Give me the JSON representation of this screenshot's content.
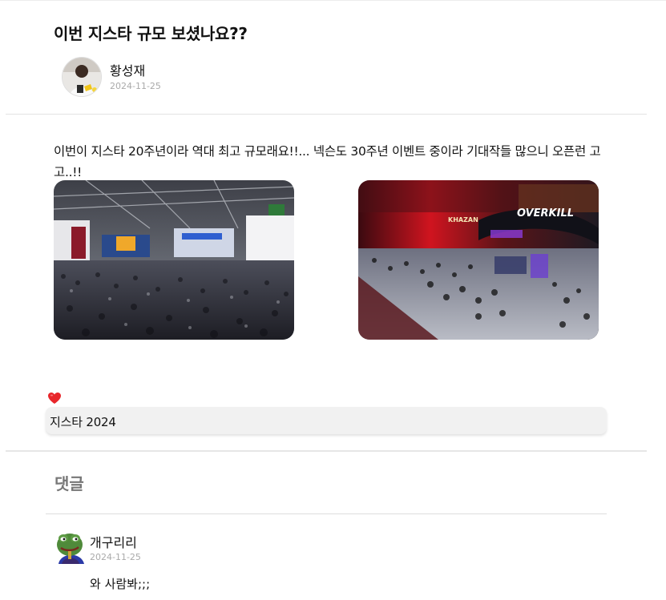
{
  "post": {
    "title": "이번 지스타 규모 보셨나요??",
    "author": {
      "name": "황성재",
      "date": "2024-11-25"
    },
    "body": "이번이 지스타 20주년이라 역대 최고 규모래요!!... 넥슨도 30주년 이벤트 중이라 기대작들 많으니 오픈런 고고..!!",
    "images": [
      {
        "name": "gstar-crowd-photo-1"
      },
      {
        "name": "gstar-crowd-photo-2",
        "signage": [
          "KHAZAN",
          "OVERKILL"
        ]
      }
    ],
    "liked": true,
    "tag": "지스타 2024"
  },
  "comments": {
    "heading": "댓글",
    "items": [
      {
        "name": "개구리리",
        "date": "2024-11-25",
        "body": "와 사람봐;;;"
      }
    ]
  },
  "colors": {
    "heart": "#e8262b",
    "muted_text": "#aaaaaa",
    "tag_bg": "#f1f1f1"
  },
  "icons": {
    "like": "heart-icon"
  }
}
